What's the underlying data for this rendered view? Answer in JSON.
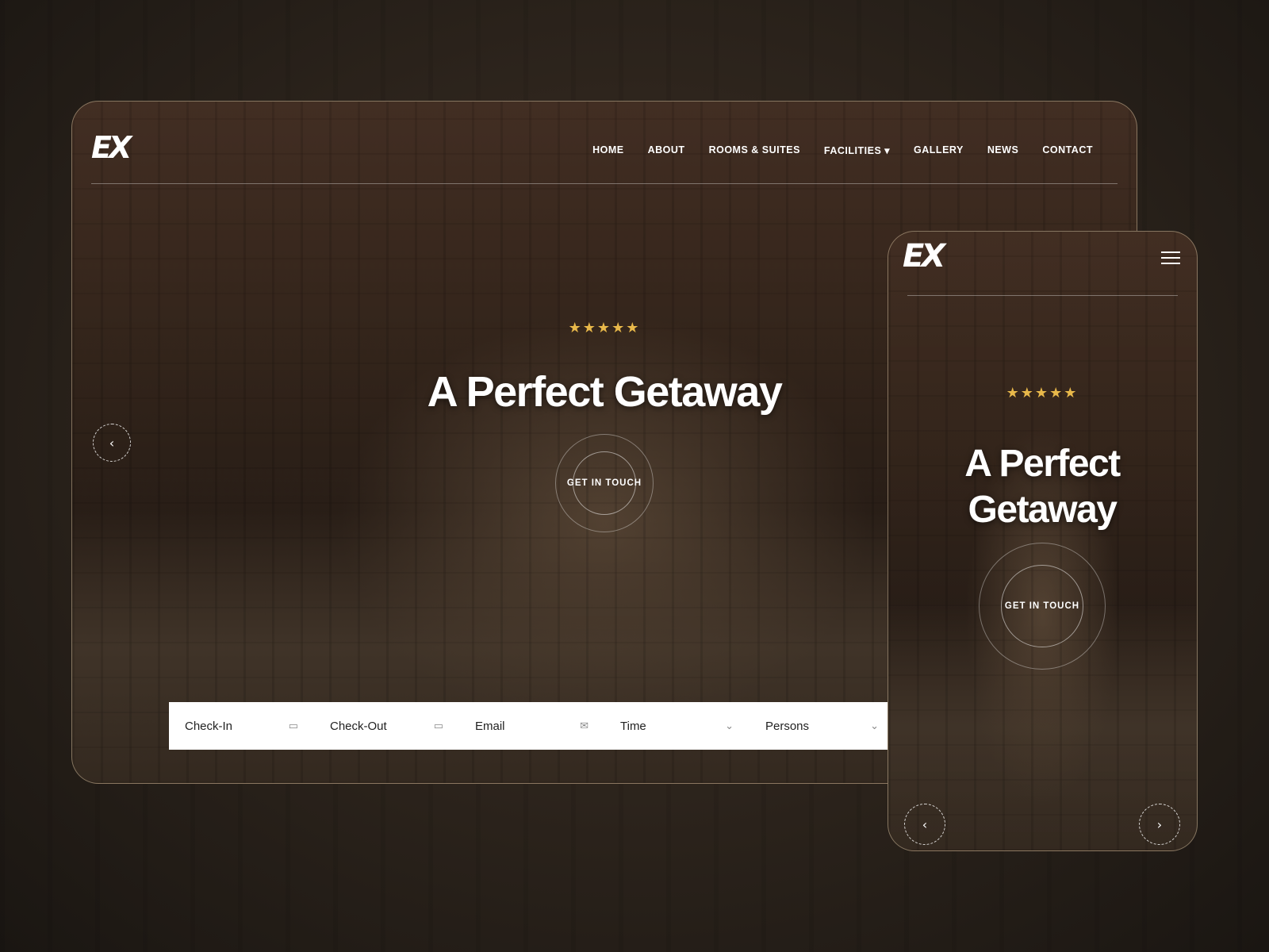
{
  "desktop": {
    "logo": "EX",
    "nav": [
      "HOME",
      "ABOUT",
      "ROOMS & SUITES",
      "FACILITIES ▾",
      "GALLERY",
      "NEWS",
      "CONTACT"
    ],
    "stars": "★★★★★",
    "rating": 5,
    "title": "A Perfect Getaway",
    "cta": "GET IN TOUCH",
    "prev": "‹",
    "form": [
      {
        "label": "Check-In",
        "icon": "calendar-icon",
        "glyph": "▭"
      },
      {
        "label": "Check-Out",
        "icon": "calendar-icon",
        "glyph": "▭"
      },
      {
        "label": "Email",
        "icon": "envelope-icon",
        "glyph": "✉"
      },
      {
        "label": "Time",
        "icon": "chevron-down-icon",
        "glyph": "⌄"
      },
      {
        "label": "Persons",
        "icon": "chevron-down-icon",
        "glyph": "⌄"
      }
    ]
  },
  "mobile": {
    "logo": "EX",
    "stars": "★★★★★",
    "title_line1": "A Perfect",
    "title_line2": "Getaway",
    "cta": "GET IN TOUCH",
    "prev": "‹",
    "next": "›"
  },
  "colors": {
    "star": "#e8b84a",
    "form_bg": "#ffffff"
  }
}
